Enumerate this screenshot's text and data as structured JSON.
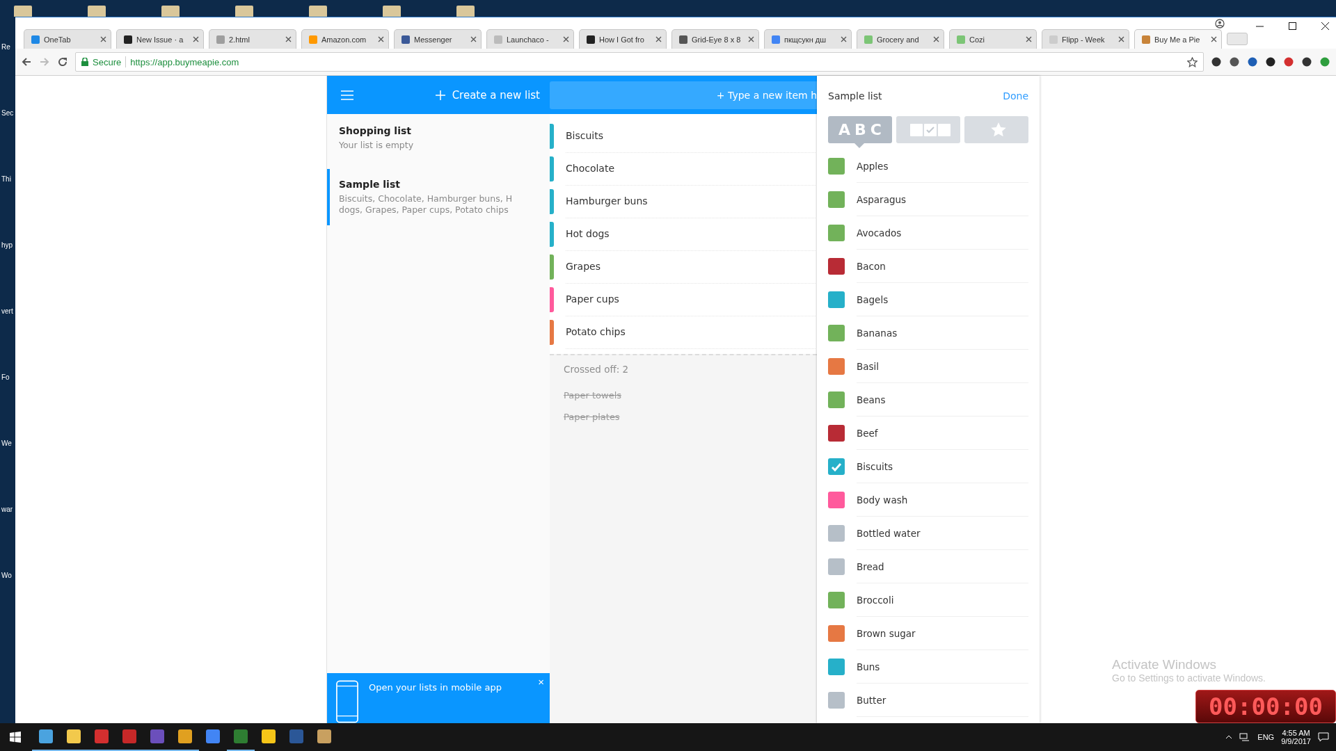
{
  "desktop": {
    "labels": [
      "Re",
      "Sec",
      "Thi",
      "hyp",
      "vert",
      "Fo",
      "We",
      "war",
      "Wo"
    ]
  },
  "browser": {
    "tabs": [
      {
        "title": "OneTab",
        "selected": false
      },
      {
        "title": "New Issue · a",
        "selected": false
      },
      {
        "title": "2.html",
        "selected": false
      },
      {
        "title": "Amazon.com",
        "selected": false
      },
      {
        "title": "Messenger",
        "selected": false
      },
      {
        "title": "Launchaco - ",
        "selected": false
      },
      {
        "title": "How I Got fro",
        "selected": false
      },
      {
        "title": "Grid-Eye 8 x 8",
        "selected": false
      },
      {
        "title": "пкщсукн дш",
        "selected": false
      },
      {
        "title": "Grocery and",
        "selected": false
      },
      {
        "title": "Cozi",
        "selected": false
      },
      {
        "title": "Flipp - Week",
        "selected": false
      },
      {
        "title": "Buy Me a Pie",
        "selected": true
      }
    ],
    "address": {
      "secure_label": "Secure",
      "url": "https://app.buymeapie.com"
    }
  },
  "header": {
    "create_label": "Create a new list",
    "new_item_placeholder": "+ Type a new item h"
  },
  "lists": [
    {
      "name": "Shopping list",
      "summary_lines": [
        "Your list is empty"
      ],
      "selected": false
    },
    {
      "name": "Sample list",
      "summary_lines": [
        "Biscuits, Chocolate, Hamburger buns, H",
        "dogs, Grapes, Paper cups, Potato chips"
      ],
      "selected": true
    }
  ],
  "items": [
    {
      "name": "Biscuits",
      "color": "#26b0c9"
    },
    {
      "name": "Chocolate",
      "color": "#26b0c9"
    },
    {
      "name": "Hamburger buns",
      "color": "#26b0c9"
    },
    {
      "name": "Hot dogs",
      "color": "#26b0c9"
    },
    {
      "name": "Grapes",
      "color": "#72b25a"
    },
    {
      "name": "Paper cups",
      "color": "#ff5a9c"
    },
    {
      "name": "Potato chips",
      "color": "#e67843"
    }
  ],
  "crossed_off": {
    "label": "Crossed off: 2",
    "items": [
      "Paper towels",
      "Paper plates"
    ]
  },
  "panel": {
    "title": "Sample list",
    "done": "Done",
    "sort_modes": [
      {
        "kind": "abc",
        "label": "ABC",
        "selected": true
      },
      {
        "kind": "checks",
        "selected": false
      },
      {
        "kind": "star",
        "selected": false
      }
    ],
    "products": [
      {
        "name": "Apples",
        "color": "#72b25a",
        "checked": false
      },
      {
        "name": "Asparagus",
        "color": "#72b25a",
        "checked": false
      },
      {
        "name": "Avocados",
        "color": "#72b25a",
        "checked": false
      },
      {
        "name": "Bacon",
        "color": "#b82b35",
        "checked": false
      },
      {
        "name": "Bagels",
        "color": "#26b0c9",
        "checked": false
      },
      {
        "name": "Bananas",
        "color": "#72b25a",
        "checked": false
      },
      {
        "name": "Basil",
        "color": "#e67843",
        "checked": false
      },
      {
        "name": "Beans",
        "color": "#72b25a",
        "checked": false
      },
      {
        "name": "Beef",
        "color": "#b82b35",
        "checked": false
      },
      {
        "name": "Biscuits",
        "color": "#26b0c9",
        "checked": true
      },
      {
        "name": "Body wash",
        "color": "#ff5a9c",
        "checked": false
      },
      {
        "name": "Bottled water",
        "color": "#b6bfc8",
        "checked": false
      },
      {
        "name": "Bread",
        "color": "#b6bfc8",
        "checked": false
      },
      {
        "name": "Broccoli",
        "color": "#72b25a",
        "checked": false
      },
      {
        "name": "Brown sugar",
        "color": "#e67843",
        "checked": false
      },
      {
        "name": "Buns",
        "color": "#26b0c9",
        "checked": false
      },
      {
        "name": "Butter",
        "color": "#b6bfc8",
        "checked": false
      }
    ]
  },
  "banner": {
    "text": "Open your lists in mobile app",
    "close": "×"
  },
  "activation": {
    "title": "Activate Windows",
    "subtitle": "Go to Settings to activate Windows."
  },
  "timer": {
    "display": "00:00:00"
  },
  "taskbar": {
    "language": "ENG",
    "time": "4:55 AM",
    "date": "9/9/2017"
  }
}
